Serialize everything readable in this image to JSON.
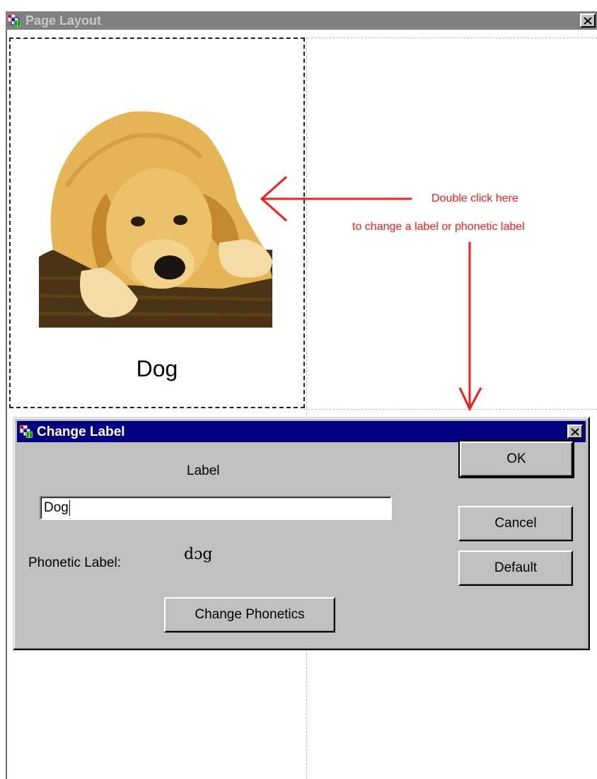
{
  "page_layout": {
    "title": "Page Layout",
    "cell": {
      "label": "Dog",
      "image": "golden-retriever-photo"
    }
  },
  "annotations": {
    "line1": "Double click here",
    "line2": "to change a label or phonetic label",
    "color": "#ff1a1a"
  },
  "dialog": {
    "title": "Change Label",
    "label_heading": "Label",
    "label_value": "Dog",
    "phonetic_label_caption": "Phonetic Label:",
    "phonetic_value": "dɔg",
    "buttons": {
      "ok": "OK",
      "cancel": "Cancel",
      "default": "Default",
      "change_phonetics": "Change Phonetics"
    },
    "title_bar_color": "#000080"
  },
  "icons": {
    "app": "app-grid-icon",
    "close": "close-icon"
  }
}
